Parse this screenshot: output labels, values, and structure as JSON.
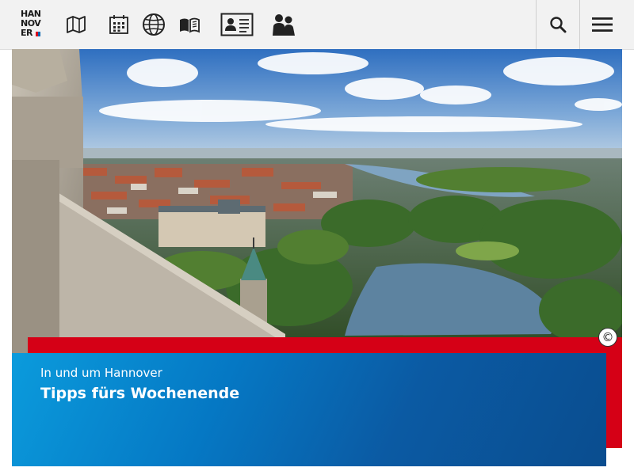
{
  "header": {
    "logo_lines": [
      "HAN",
      "NOV",
      "ER"
    ],
    "nav_icons": [
      "map-icon",
      "calendar-icon",
      "globe-icon",
      "open-book-icon",
      "id-card-icon",
      "people-icon"
    ],
    "search_icon": "search-icon",
    "menu_icon": "hamburger-menu-icon"
  },
  "hero": {
    "image": "aerial view of Hannover from the town hall tower",
    "copyright_symbol": "©"
  },
  "teaser": {
    "kicker": "In und um Hannover",
    "headline": "Tipps fürs Wochenende"
  },
  "colors": {
    "accent_red": "#d50016",
    "teaser_blue_start": "#0b9bdc",
    "teaser_blue_end": "#0a4d8f",
    "header_bg": "#f2f2f2"
  }
}
